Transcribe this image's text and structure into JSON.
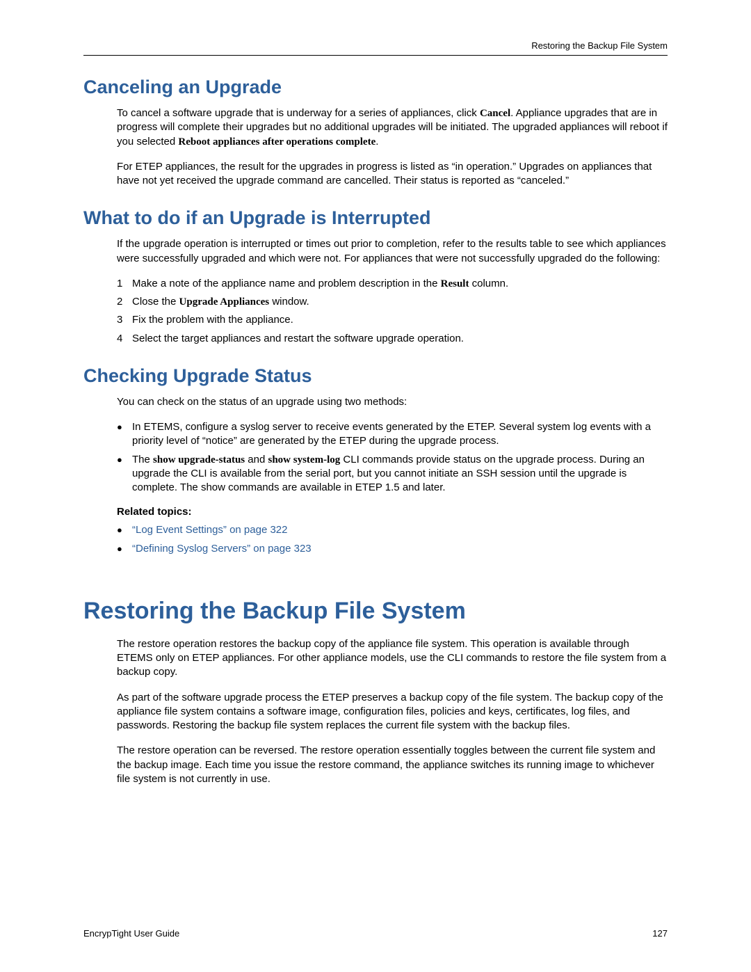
{
  "header": {
    "running": "Restoring the Backup File System"
  },
  "section1": {
    "title": "Canceling an Upgrade",
    "p1_a": "To cancel a software upgrade that is underway for a series of appliances, click ",
    "p1_b": "Cancel",
    "p1_c": ". Appliance upgrades that are in progress will complete their upgrades but no additional upgrades will be initiated. The upgraded appliances will reboot if you selected ",
    "p1_d": "Reboot appliances after operations complete",
    "p1_e": ".",
    "p2": "For ETEP appliances, the result for the upgrades in progress is listed as “in operation.” Upgrades on appliances that have not yet received the upgrade command are cancelled. Their status is reported as “canceled.”"
  },
  "section2": {
    "title": "What to do if an Upgrade is Interrupted",
    "p1": "If the upgrade operation is interrupted or times out prior to completion, refer to the results table to see which appliances were successfully upgraded and which were not. For appliances that were not successfully upgraded do the following:",
    "items": [
      {
        "n": "1",
        "a": "Make a note of the appliance name and problem description in the ",
        "b": "Result",
        "c": " column."
      },
      {
        "n": "2",
        "a": "Close the ",
        "b": "Upgrade Appliances",
        "c": " window."
      },
      {
        "n": "3",
        "a": "Fix the problem with the appliance.",
        "b": "",
        "c": ""
      },
      {
        "n": "4",
        "a": "Select the target appliances and restart the software upgrade operation.",
        "b": "",
        "c": ""
      }
    ]
  },
  "section3": {
    "title": "Checking Upgrade Status",
    "p1": "You can check on the status of an upgrade using two methods:",
    "b1": "In ETEMS, configure a syslog server to receive events generated by the ETEP. Several system log events with a priority level of “notice” are generated by the ETEP during the upgrade process.",
    "b2_a": "The ",
    "b2_b": "show upgrade-status",
    "b2_c": " and ",
    "b2_d": "show system-log",
    "b2_e": " CLI commands provide status on the upgrade process. During an upgrade the CLI is available from the serial port, but you cannot initiate an SSH session until the upgrade is complete. The show commands are available in ETEP 1.5 and later.",
    "related_label": "Related topics:",
    "link1": "“Log Event Settings” on page 322",
    "link2": "“Defining Syslog Servers” on page 323"
  },
  "section4": {
    "title": "Restoring the Backup File System",
    "p1": "The restore operation restores the backup copy of the appliance file system. This operation is available through ETEMS only on ETEP appliances. For other appliance models, use the CLI commands to restore the file system from a backup copy.",
    "p2": "As part of the software upgrade process the ETEP preserves a backup copy of the file system. The backup copy of the appliance file system contains a software image, configuration files, policies and keys, certificates, log files, and passwords. Restoring the backup file system replaces the current file system with the backup files.",
    "p3": "The restore operation can be reversed. The restore operation essentially toggles between the current file system and the backup image. Each time you issue the restore command, the appliance switches its running image to whichever file system is not currently in use."
  },
  "footer": {
    "left": "EncrypTight User Guide",
    "right": "127"
  }
}
